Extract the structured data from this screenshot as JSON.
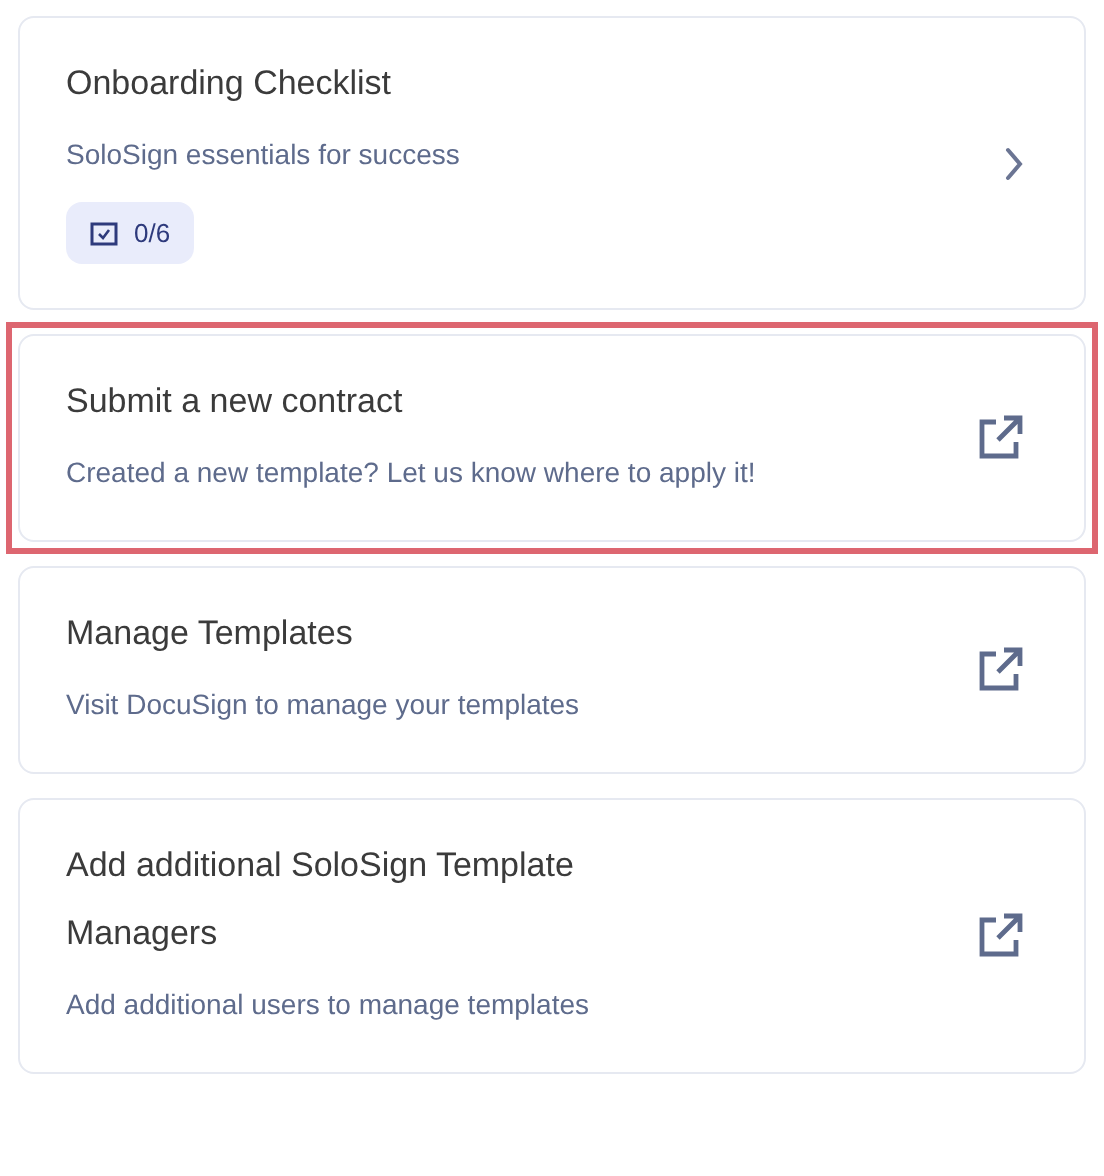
{
  "cards": [
    {
      "kind": "checklist",
      "title": "Onboarding Checklist",
      "subtitle": "SoloSign essentials for success",
      "progress": "0/6",
      "highlighted": false
    },
    {
      "kind": "link",
      "title": "Submit a new contract",
      "subtitle": "Created a new template? Let us know where to apply it!",
      "highlighted": true
    },
    {
      "kind": "link",
      "title": "Manage Templates",
      "subtitle": "Visit DocuSign to manage your templates",
      "highlighted": false
    },
    {
      "kind": "link",
      "title": "Add additional SoloSign Template Managers",
      "subtitle": "Add additional users to manage templates",
      "highlighted": false
    }
  ]
}
